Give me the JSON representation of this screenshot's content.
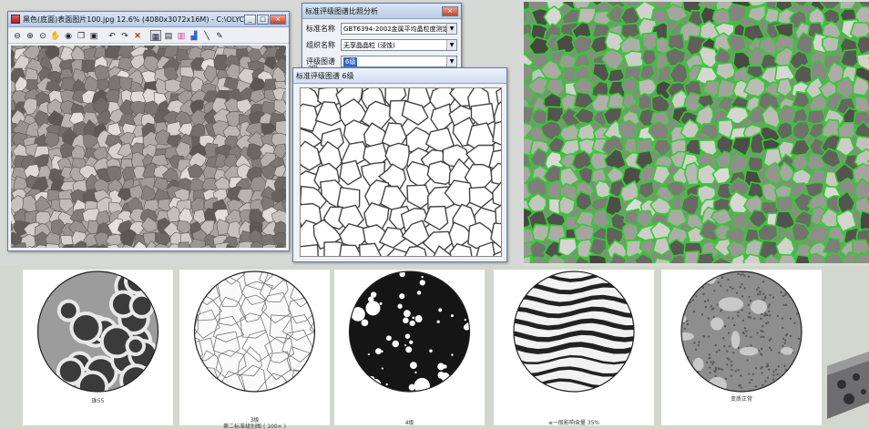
{
  "viewer": {
    "title": "黑色(底面)表面图片100.jpg 12.6% (4080x3072x16M) - C:\\OLYCIA Pro...",
    "toolbar_icons": [
      "zoom-out-icon",
      "zoom-in-icon",
      "zoom-fit-icon",
      "hand-icon",
      "zoom-area-icon",
      "copy-icon",
      "save-icon",
      "undo-icon",
      "redo-icon",
      "delete-icon",
      "grid-icon",
      "filter-icon",
      "palette-icon",
      "histogram-icon",
      "measure-icon",
      "brush-icon"
    ]
  },
  "dialog": {
    "title": "标准评级图谱比照分析",
    "fields": [
      {
        "label": "标准名称",
        "value": "GBT6394-2002金属平均晶粒度测定方"
      },
      {
        "label": "组织名称",
        "value": "无孪晶晶粒 (浸蚀)"
      },
      {
        "label": "评级图谱",
        "value": "6级"
      }
    ],
    "below_text": "3级"
  },
  "chart_window": {
    "title": "标准评级图谱 6级"
  },
  "cards": [
    {
      "caption_lines": [
        "珠55"
      ]
    },
    {
      "caption_lines": [
        "3级",
        "第二标准级别图 ( 100× )"
      ]
    },
    {
      "caption_lines": [
        "4级"
      ]
    },
    {
      "caption_lines": [
        "≤一般影响含量 35%"
      ]
    },
    {
      "caption_lines": [
        "变质正常"
      ]
    }
  ]
}
